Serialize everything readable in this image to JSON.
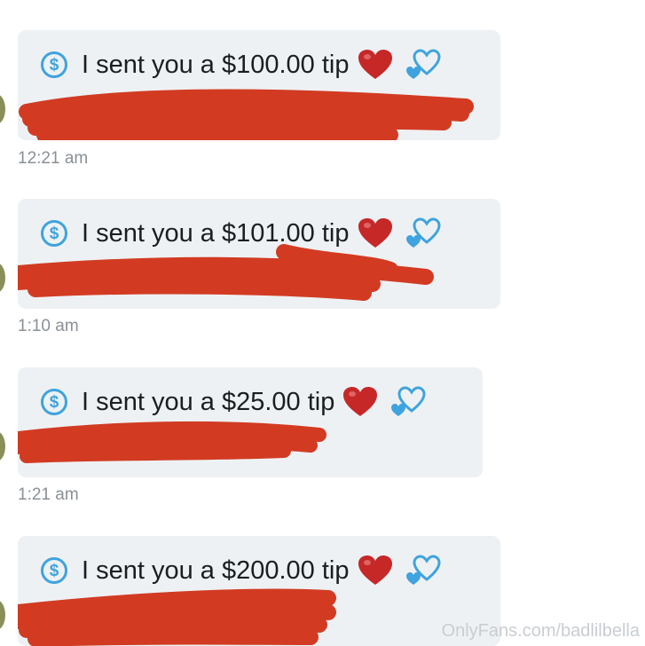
{
  "messages": [
    {
      "text": "I sent you a $100.00 tip",
      "time": "12:21 am",
      "icon": "dollar-icon",
      "emoji": [
        "red-heart-icon",
        "two-hearts-icon"
      ]
    },
    {
      "text": "I sent you a $101.00 tip",
      "time": "1:10 am",
      "icon": "dollar-icon",
      "emoji": [
        "red-heart-icon",
        "two-hearts-icon"
      ]
    },
    {
      "text": "I sent you a $25.00 tip",
      "time": "1:21 am",
      "icon": "dollar-icon",
      "emoji": [
        "red-heart-icon",
        "two-hearts-icon"
      ]
    },
    {
      "text": "I sent you a $200.00 tip",
      "time": "",
      "icon": "dollar-icon",
      "emoji": [
        "red-heart-icon",
        "two-hearts-icon"
      ]
    }
  ],
  "dollar_symbol": "$",
  "watermark": "OnlyFans.com/badlilbella",
  "colors": {
    "bubble": "#eef1f4",
    "accent_blue": "#3ea3de",
    "heart_red": "#c62828",
    "redaction": "#d23b22",
    "timestamp": "#8a9096"
  }
}
